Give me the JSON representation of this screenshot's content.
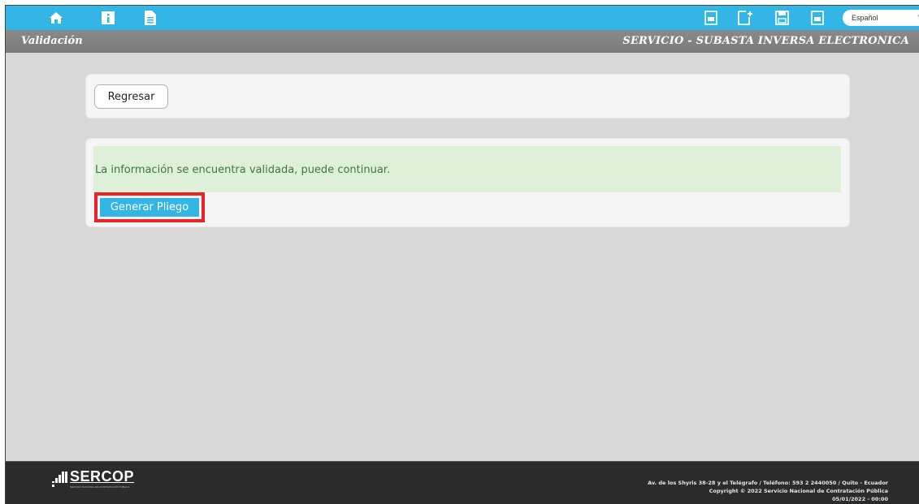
{
  "toolbar": {
    "icons": [
      "home-icon",
      "info-icon",
      "document-icon",
      "pdf-icon",
      "new-document-icon",
      "save-icon",
      "pdf-icon-2"
    ],
    "language": {
      "selected": "Español",
      "chevron": "v"
    }
  },
  "header": {
    "left_title": "Validación",
    "right_title": "SERVICIO - SUBASTA INVERSA ELECTRONICA"
  },
  "actions": {
    "back_label": "Regresar"
  },
  "validation": {
    "message": "La información se encuentra validada, puede continuar.",
    "generate_label": "Generar Pliego"
  },
  "footer": {
    "logo_text": "SERCOP",
    "logo_tagline": "SERVICIO NACIONAL DE CONTRATACIÓN PÚBLICA",
    "address": "Av. de los Shyris 38-28 y el Telégrafo / Teléfono: 593 2 2440050 / Quito - Ecuador",
    "copyright": "Copyright © 2022 Servicio Nacional de Contratación Pública",
    "timestamp": "05/01/2022 - 00:00"
  },
  "colors": {
    "accent": "#33b5e5",
    "titlebar": "#808080",
    "success_bg": "#dff0d8",
    "success_text": "#3c763d",
    "highlight": "#e8232a",
    "footer_bg": "#2b2b2b"
  }
}
